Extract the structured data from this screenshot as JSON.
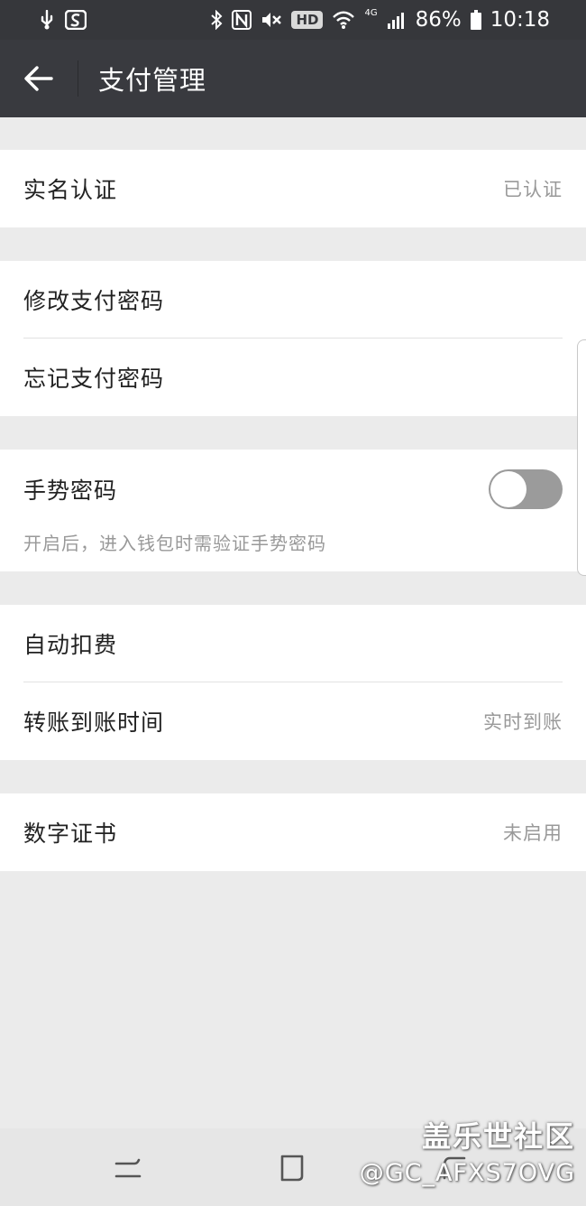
{
  "status_bar": {
    "left_icons": [
      "usb-debug-icon",
      "sogou-input-icon"
    ],
    "right_icons": [
      "bluetooth-icon",
      "nfc-icon",
      "mute-icon"
    ],
    "hd_label": "HD",
    "network_label": "4G",
    "battery_percent": "86%",
    "time": "10:18"
  },
  "app_bar": {
    "back_icon": "arrow-left-icon",
    "title": "支付管理"
  },
  "sections": {
    "identity": {
      "label": "实名认证",
      "value": "已认证"
    },
    "password": {
      "change_label": "修改支付密码",
      "forgot_label": "忘记支付密码"
    },
    "gesture": {
      "label": "手势密码",
      "enabled": false,
      "hint": "开启后，进入钱包时需验证手势密码"
    },
    "payments": {
      "auto_deduct_label": "自动扣费",
      "transfer_time_label": "转账到账时间",
      "transfer_time_value": "实时到账"
    },
    "certificate": {
      "label": "数字证书",
      "value": "未启用"
    }
  },
  "watermark": {
    "title": "盖乐世社区",
    "handle": "@GC_AFXS7OVG"
  },
  "colors": {
    "status_bar": "#36373b",
    "app_bar": "#393a3f",
    "background": "#ebebeb",
    "toggle_off": "#9b9b9b"
  }
}
